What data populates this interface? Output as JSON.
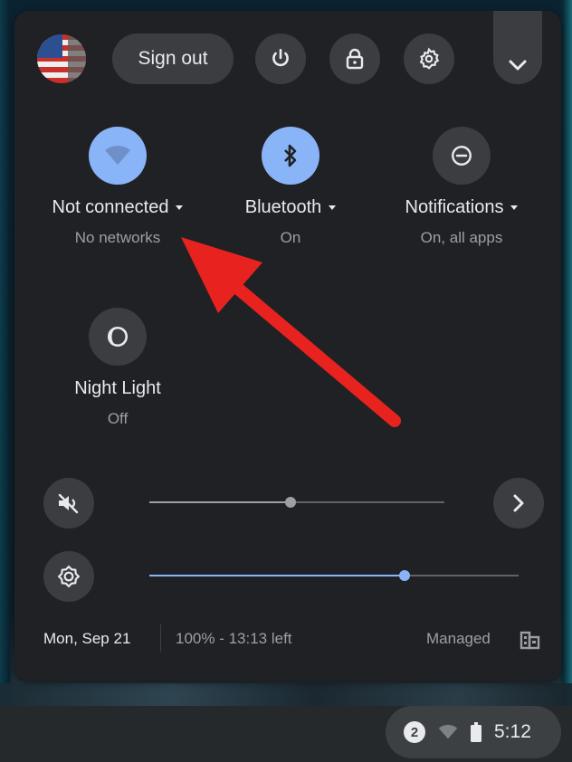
{
  "header": {
    "sign_out_label": "Sign out",
    "icons": [
      "power-icon",
      "lock-icon",
      "settings-icon",
      "chevron-down-icon"
    ]
  },
  "tiles": [
    {
      "label": "Not connected",
      "sub": "No networks",
      "icon": "wifi-icon",
      "state": "on",
      "has_menu": true
    },
    {
      "label": "Bluetooth",
      "sub": "On",
      "icon": "bluetooth-icon",
      "state": "on",
      "has_menu": true
    },
    {
      "label": "Notifications",
      "sub": "On, all apps",
      "icon": "do-not-disturb-icon",
      "state": "off",
      "has_menu": true
    },
    {
      "label": "Night Light",
      "sub": "Off",
      "icon": "night-light-icon",
      "state": "off",
      "has_menu": false
    }
  ],
  "sliders": {
    "volume": {
      "icon": "volume-muted-icon",
      "level": 0.45,
      "muted": true
    },
    "brightness": {
      "icon": "brightness-icon",
      "level": 0.69
    }
  },
  "footer": {
    "date": "Mon, Sep 21",
    "battery": "100% - 13:13 left",
    "managed": "Managed"
  },
  "tray": {
    "notification_count": "2",
    "time": "5:12"
  },
  "colors": {
    "panel": "#202124",
    "accent": "#8ab4f8",
    "button": "#3b3d40",
    "annotation_arrow": "#e8231f"
  }
}
